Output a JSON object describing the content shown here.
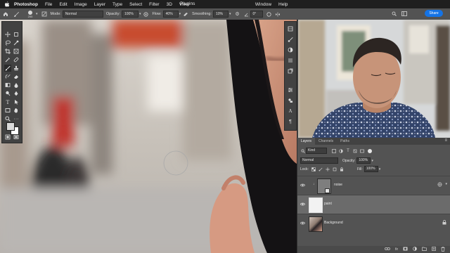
{
  "menubar": {
    "app_name": "Photoshop",
    "items": [
      "File",
      "Edit",
      "Image",
      "Layer",
      "Type",
      "Select",
      "Filter",
      "3D",
      "View",
      "Window",
      "Help",
      "Plugins"
    ]
  },
  "options_bar": {
    "brush_size": "200",
    "mode_label": "Mode:",
    "mode_value": "Normal",
    "opacity_label": "Opacity:",
    "opacity_value": "100%",
    "flow_label": "Flow:",
    "flow_value": "40%",
    "smoothing_label": "Smoothing:",
    "smoothing_value": "10%",
    "angle_value": "0°",
    "share_label": "Share"
  },
  "layers_panel": {
    "tabs": [
      "Layers",
      "Channels",
      "Paths"
    ],
    "filter_kind": "Kind",
    "blend_mode": "Normal",
    "opacity_label": "Opacity:",
    "opacity_value": "100%",
    "lock_label": "Lock:",
    "fill_label": "Fill:",
    "fill_value": "100%",
    "layers": [
      {
        "name": "noise",
        "selected": false
      },
      {
        "name": "paint",
        "selected": true
      },
      {
        "name": "Background",
        "selected": false
      }
    ],
    "bottom_icons": [
      "link-icon",
      "fx-icon",
      "mask-icon",
      "adjustment-icon",
      "group-icon",
      "new-layer-icon",
      "trash-icon"
    ]
  },
  "colors": {
    "menubar_bg": "#1f1f1f",
    "panel_bg": "#535353",
    "accent": "#1473e6",
    "selected_layer": "#6b6b6b"
  }
}
